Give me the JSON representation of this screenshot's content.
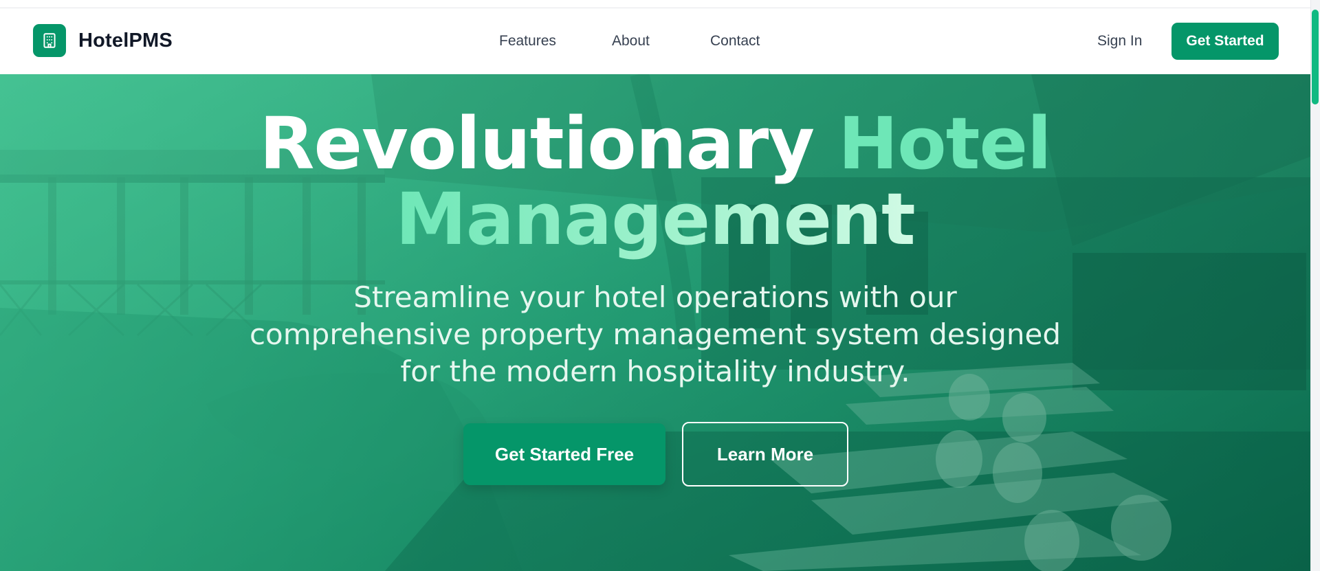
{
  "brand": {
    "name": "HotelPMS",
    "logo_icon": "building-icon",
    "color": "#059669"
  },
  "nav": {
    "links": [
      {
        "label": "Features"
      },
      {
        "label": "About"
      },
      {
        "label": "Contact"
      }
    ],
    "sign_in": "Sign In",
    "get_started": "Get Started"
  },
  "hero": {
    "headline_part1": "Revolutionary",
    "headline_part2": "Hotel",
    "headline_part3": "Management",
    "subheadline": "Streamline your hotel operations with our comprehensive property management system designed for the modern hospitality industry.",
    "primary_cta": "Get Started Free",
    "secondary_cta": "Learn More",
    "background_image": "hotel-poolside-lounge-photo"
  },
  "colors": {
    "accent": "#059669",
    "accent_light": "#6ee7b7",
    "text_dark": "#111827"
  }
}
